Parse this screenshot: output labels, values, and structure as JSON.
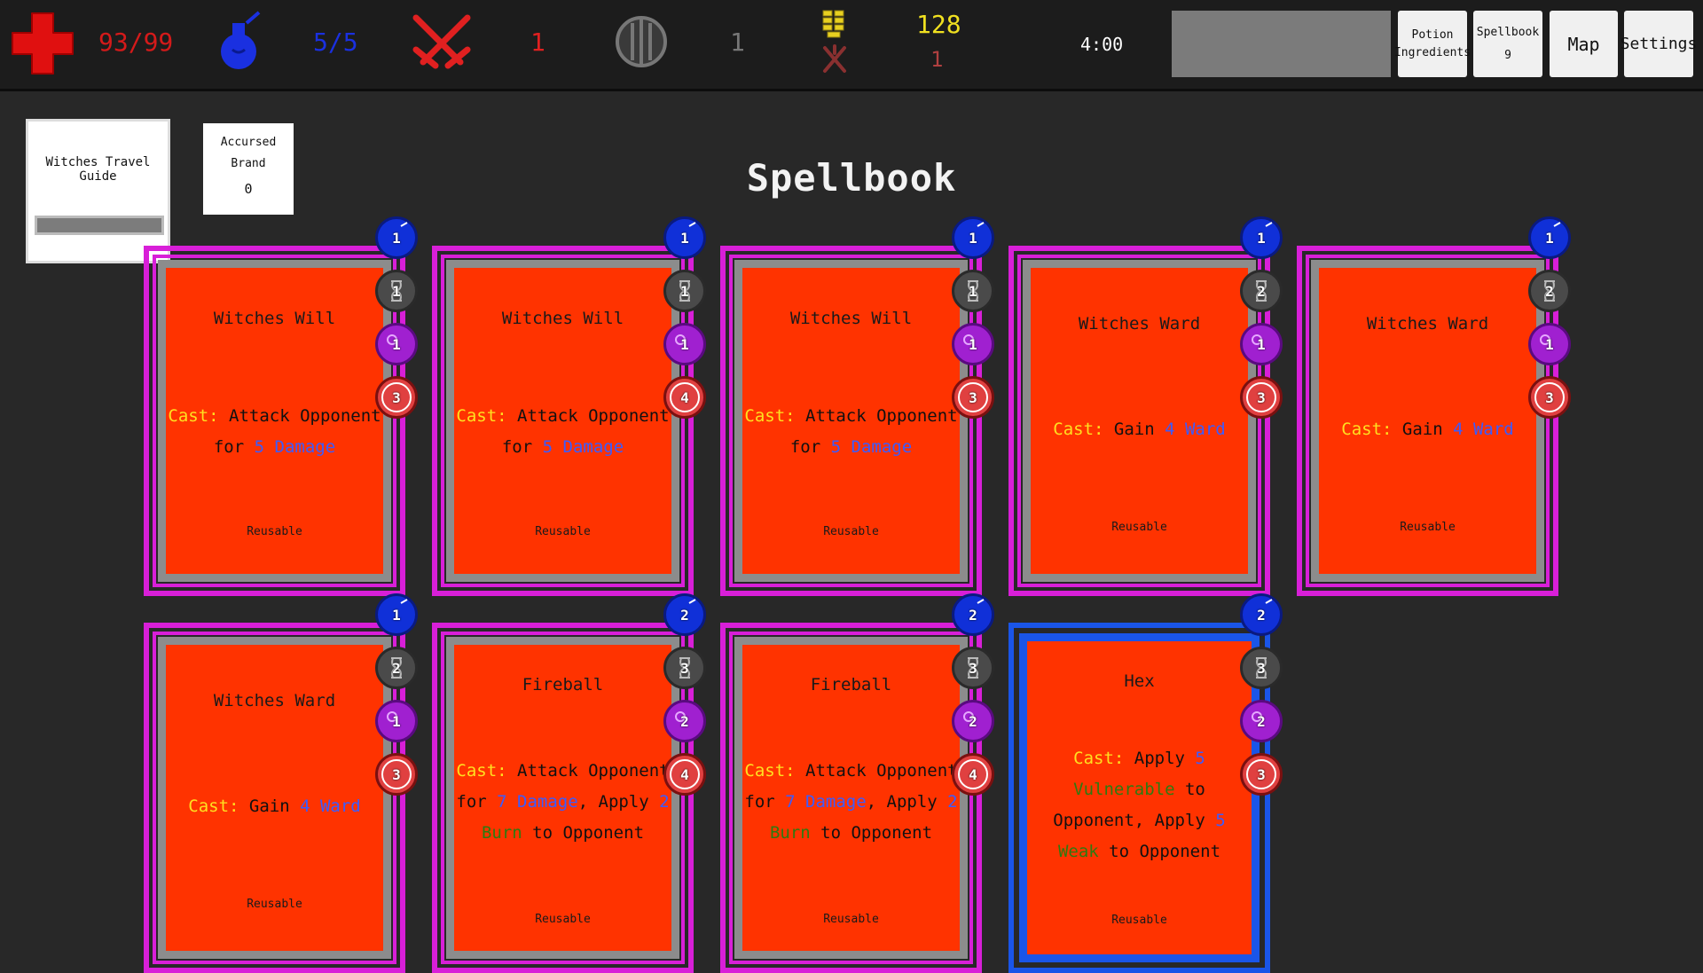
{
  "hud": {
    "health": "93/99",
    "mana": "5/5",
    "attack": "1",
    "defense": "1",
    "gold": "128",
    "enemies": "1",
    "timer": "4:00",
    "buttons": {
      "potion_line1": "Potion",
      "potion_line2": "Ingredients",
      "spellbook_label": "Spellbook",
      "spellbook_count": "9",
      "map": "Map",
      "settings": "Settings"
    },
    "colors": {
      "health": "#d41a1a",
      "mana": "#1a30e0",
      "attack": "#e02020",
      "gold": "#f0e020"
    }
  },
  "relics": [
    {
      "name": "Witches Travel Guide"
    },
    {
      "name_line1": "Accursed",
      "name_line2": "Brand",
      "count": "0"
    }
  ],
  "title": "Spellbook",
  "cards": [
    {
      "name": "Witches Will",
      "mana": "1",
      "time": "1",
      "hex": "1",
      "ign": "3",
      "desc": [
        {
          "t": "Cast:",
          "c": "cast"
        },
        {
          "t": " Attack Opponent "
        },
        {
          "br": true
        },
        {
          "t": "for "
        },
        {
          "t": "5 Damage",
          "c": "num"
        }
      ],
      "footer": "Reusable"
    },
    {
      "name": "Witches Will",
      "mana": "1",
      "time": "1",
      "hex": "1",
      "ign": "4",
      "desc": [
        {
          "t": "Cast:",
          "c": "cast"
        },
        {
          "t": " Attack Opponent "
        },
        {
          "br": true
        },
        {
          "t": "for "
        },
        {
          "t": "5 Damage",
          "c": "num"
        }
      ],
      "footer": "Reusable"
    },
    {
      "name": "Witches Will",
      "mana": "1",
      "time": "1",
      "hex": "1",
      "ign": "3",
      "desc": [
        {
          "t": "Cast:",
          "c": "cast"
        },
        {
          "t": " Attack Opponent "
        },
        {
          "br": true
        },
        {
          "t": "for "
        },
        {
          "t": "5 Damage",
          "c": "num"
        }
      ],
      "footer": "Reusable"
    },
    {
      "name": "Witches Ward",
      "mana": "1",
      "time": "2",
      "hex": "1",
      "ign": "3",
      "desc": [
        {
          "t": "Cast:",
          "c": "cast"
        },
        {
          "t": " Gain "
        },
        {
          "t": "4 Ward",
          "c": "num"
        }
      ],
      "footer": "Reusable"
    },
    {
      "name": "Witches Ward",
      "mana": "1",
      "time": "2",
      "hex": "1",
      "ign": "3",
      "desc": [
        {
          "t": "Cast:",
          "c": "cast"
        },
        {
          "t": " Gain "
        },
        {
          "t": "4 Ward",
          "c": "num"
        }
      ],
      "footer": "Reusable"
    },
    {
      "name": "Witches Ward",
      "mana": "1",
      "time": "2",
      "hex": "1",
      "ign": "3",
      "desc": [
        {
          "t": "Cast:",
          "c": "cast"
        },
        {
          "t": " Gain "
        },
        {
          "t": "4 Ward",
          "c": "num"
        }
      ],
      "footer": "Reusable"
    },
    {
      "name": "Fireball",
      "mana": "2",
      "time": "3",
      "hex": "2",
      "ign": "4",
      "desc": [
        {
          "t": "Cast:",
          "c": "cast"
        },
        {
          "t": " Attack Opponent "
        },
        {
          "br": true
        },
        {
          "t": "for "
        },
        {
          "t": "7 Damage",
          "c": "num"
        },
        {
          "t": ", Apply "
        },
        {
          "t": "2",
          "c": "num"
        },
        {
          "br": true
        },
        {
          "t": "Burn",
          "c": "green"
        },
        {
          "t": " to Opponent"
        }
      ],
      "footer": "Reusable"
    },
    {
      "name": "Fireball",
      "mana": "2",
      "time": "3",
      "hex": "2",
      "ign": "4",
      "desc": [
        {
          "t": "Cast:",
          "c": "cast"
        },
        {
          "t": " Attack Opponent "
        },
        {
          "br": true
        },
        {
          "t": "for "
        },
        {
          "t": "7 Damage",
          "c": "num"
        },
        {
          "t": ", Apply "
        },
        {
          "t": "2",
          "c": "num"
        },
        {
          "br": true
        },
        {
          "t": "Burn",
          "c": "green"
        },
        {
          "t": " to Opponent"
        }
      ],
      "footer": "Reusable"
    },
    {
      "name": "Hex",
      "mana": "2",
      "time": "3",
      "hex": "2",
      "ign": "3",
      "desc": [
        {
          "t": "Cast:",
          "c": "cast"
        },
        {
          "t": " Apply "
        },
        {
          "t": "5",
          "c": "num"
        },
        {
          "br": true
        },
        {
          "t": "Vulnerable",
          "c": "green"
        },
        {
          "t": " to"
        },
        {
          "br": true
        },
        {
          "t": "Opponent, Apply "
        },
        {
          "t": "5",
          "c": "num"
        },
        {
          "br": true
        },
        {
          "t": "Weak",
          "c": "green"
        },
        {
          "t": " to Opponent"
        }
      ],
      "footer": "Reusable"
    }
  ]
}
